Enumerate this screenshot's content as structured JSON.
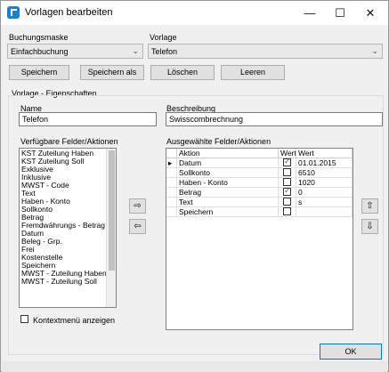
{
  "window": {
    "title": "Vorlagen bearbeiten",
    "minimize": "—",
    "maximize": "☐",
    "close": "✕"
  },
  "buchungsmaske": {
    "label": "Buchungsmaske",
    "value": "Einfachbuchung"
  },
  "vorlage": {
    "label": "Vorlage",
    "value": "Telefon"
  },
  "toolbar": {
    "speichern": "Speichern",
    "speichern_als": "Speichern als",
    "loeschen": "Löschen",
    "leeren": "Leeren"
  },
  "properties": {
    "group_label": "Vorlage - Eigenschaften",
    "name_label": "Name",
    "name_value": "Telefon",
    "beschreibung_label": "Beschreibung",
    "beschreibung_value": "Swisscombrechnung"
  },
  "available": {
    "label": "Verfügbare Felder/Aktionen",
    "items": [
      "KST Zuteilung Haben",
      "KST Zuteilung Soll",
      "Exklusive",
      "Inklusive",
      "MWST - Code",
      "Text",
      "Haben - Konto",
      "Sollkonto",
      "Betrag",
      "Fremdwährungs - Betrag",
      "Datum",
      "Beleg - Grp.",
      "Frei",
      "Kostenstelle",
      "Speichern",
      "MWST - Zuteilung Haben",
      "MWST - Zuteilung Soll"
    ]
  },
  "transfer": {
    "add": "⇨",
    "remove": "⇦"
  },
  "selected": {
    "label": "Ausgewählte Felder/Aktionen",
    "columns": [
      "Aktion",
      "Wert...",
      "Wert"
    ],
    "rows": [
      {
        "aktion": "Datum",
        "checked": true,
        "wert": "01.01.2015"
      },
      {
        "aktion": "Sollkonto",
        "checked": false,
        "wert": "6510"
      },
      {
        "aktion": "Haben - Konto",
        "checked": false,
        "wert": "1020"
      },
      {
        "aktion": "Betrag",
        "checked": true,
        "wert": "0"
      },
      {
        "aktion": "Text",
        "checked": false,
        "wert": "s"
      },
      {
        "aktion": "Speichern",
        "checked": false,
        "wert": ""
      }
    ]
  },
  "order": {
    "up": "⇧",
    "down": "⇩"
  },
  "context_menu": {
    "label": "Kontextmenü anzeigen",
    "checked": false
  },
  "ok": "OK"
}
